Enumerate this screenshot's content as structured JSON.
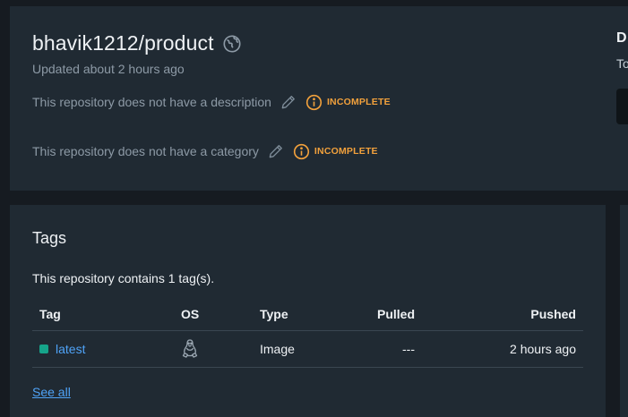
{
  "repo": {
    "title": "bhavik1212/product",
    "updated": "Updated about 2 hours ago",
    "description_text": "This repository does not have a description",
    "category_text": "This repository does not have a category",
    "badge_label": "INCOMPLETE",
    "globe_icon": "globe-icon",
    "edit_icon": "pencil-icon",
    "badge_icon": "info-circle-icon"
  },
  "side": {
    "heading": "D",
    "sub": "To"
  },
  "tags": {
    "heading": "Tags",
    "count_text": "This repository contains 1 tag(s).",
    "columns": [
      "Tag",
      "OS",
      "Type",
      "Pulled",
      "Pushed"
    ],
    "rows": [
      {
        "tag": "latest",
        "os_icon": "linux-icon",
        "type": "Image",
        "pulled": "---",
        "pushed": "2 hours ago"
      }
    ],
    "see_all": "See all"
  },
  "colors": {
    "background": "#161b21",
    "card": "#202a33",
    "warning": "#f2a13c",
    "link": "#4fa3f7",
    "tag_dot": "#16a48a"
  }
}
